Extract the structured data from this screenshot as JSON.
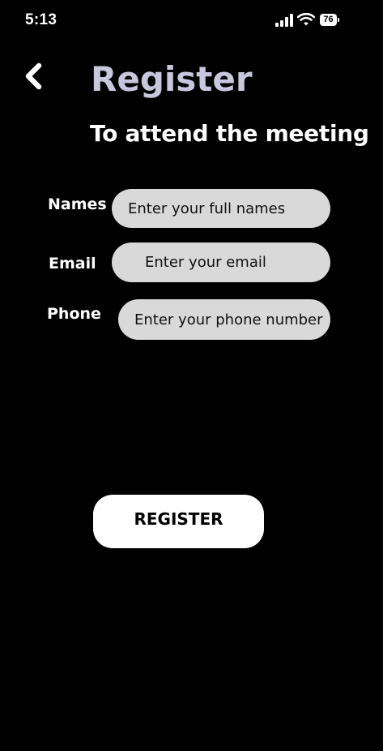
{
  "status_bar": {
    "time": "5:13",
    "battery": "76",
    "icons": [
      "signal-icon",
      "wifi-icon",
      "battery-icon"
    ]
  },
  "header": {
    "back_icon": "chevron-left-icon",
    "title": "Register",
    "subtitle": "To attend the meeting"
  },
  "form": {
    "names": {
      "label": "Names",
      "value": "",
      "placeholder": "Enter your full names"
    },
    "email": {
      "label": "Email",
      "value": "",
      "placeholder": "Enter your email"
    },
    "phone": {
      "label": "Phone",
      "value": "",
      "placeholder": "Enter your phone number"
    }
  },
  "actions": {
    "register_label": "REGISTER"
  },
  "colors": {
    "background": "#000000",
    "title": "#c9c7dd",
    "input_fill": "#d9d9d9",
    "button_fill": "#ffffff"
  }
}
